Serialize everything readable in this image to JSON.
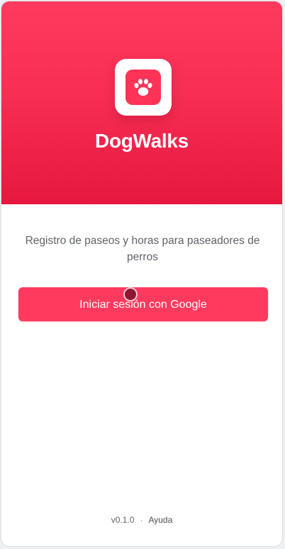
{
  "app": {
    "name": "DogWalks",
    "logo_icon": "paw-icon"
  },
  "main": {
    "description": "Registro de paseos y horas para paseadores de perros",
    "google_signin_label": "Iniciar sesión con Google"
  },
  "footer": {
    "version": "v0.1.0",
    "separator": "·",
    "help_label": "Ayuda"
  },
  "colors": {
    "brand": "#ff3a5e",
    "brand_dark": "#e6183f",
    "text_muted": "#5f6368"
  }
}
